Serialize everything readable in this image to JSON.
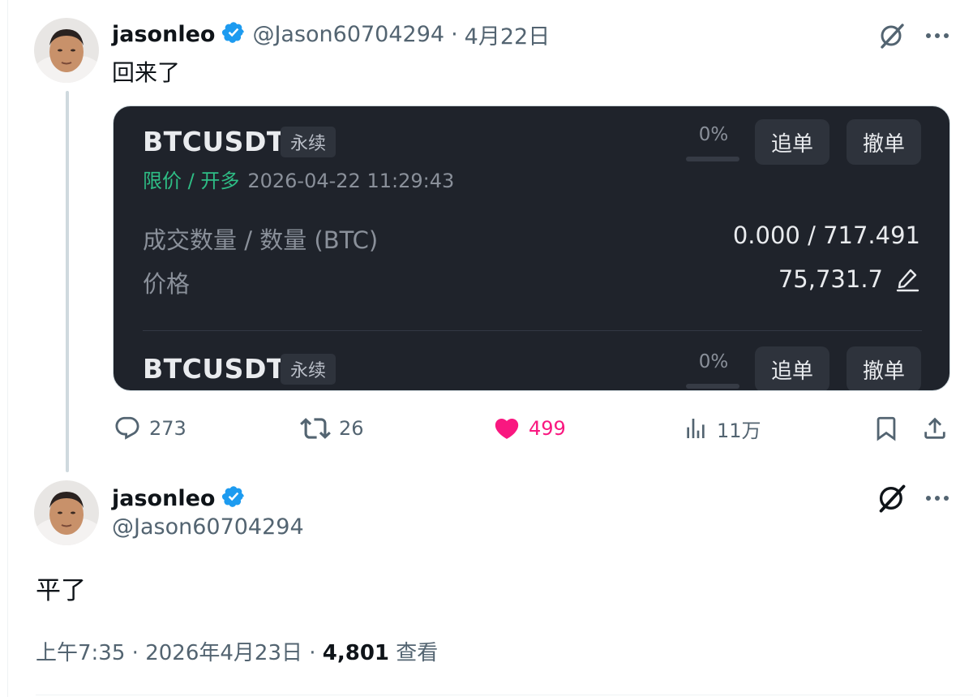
{
  "tweet1": {
    "name": "jasonleo",
    "handle": "@Jason60704294",
    "separator": "·",
    "date": "4月22日",
    "text": "回来了",
    "card": {
      "order1": {
        "symbol": "BTCUSDT",
        "tag": "永续",
        "percent": "0%",
        "follow_label": "追单",
        "cancel_label": "撤单",
        "type_label": "限价 / 开多",
        "timestamp": "2026-04-22 11:29:43",
        "qty_label": "成交数量 / 数量 (BTC)",
        "qty_value": "0.000 / 717.491",
        "price_label": "价格",
        "price_value": "75,731.7"
      },
      "order2": {
        "symbol": "BTCUSDT",
        "tag": "永续",
        "percent": "0%",
        "follow_label": "追单",
        "cancel_label": "撤单"
      }
    },
    "actions": {
      "replies": "273",
      "reposts": "26",
      "likes": "499",
      "views": "11万"
    }
  },
  "tweet2": {
    "name": "jasonleo",
    "handle": "@Jason60704294",
    "text": "平了",
    "time": "上午7:35",
    "separator": "·",
    "date": "2026年4月23日",
    "views_count": "4,801",
    "views_label": "查看"
  },
  "colors": {
    "verified": "#1d9bf0",
    "like": "#f91880",
    "muted": "#536471",
    "card_bg": "#1f232b",
    "long_green": "#2ebd85"
  }
}
